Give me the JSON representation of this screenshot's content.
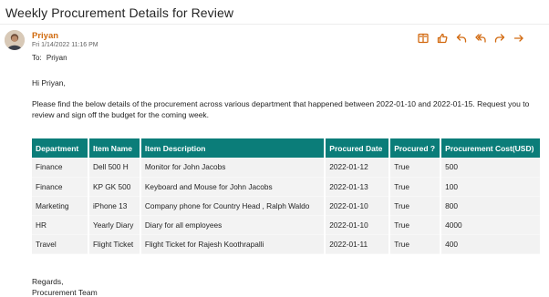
{
  "email": {
    "subject": "Weekly Procurement Details for Review",
    "sender": "Priyan",
    "sent": "Fri 1/14/2022 11:16 PM",
    "to_label": "To:",
    "to": "Priyan",
    "greeting": "Hi Priyan,",
    "intro": "Please find the below details of the procurement across various department that happened between 2022-01-10 and 2022-01-15. Request you to review and sign off the budget for the coming week.",
    "closing": "Regards,",
    "signature": "Procurement Team"
  },
  "actions": [
    {
      "name": "immersive-reader-icon"
    },
    {
      "name": "like-icon"
    },
    {
      "name": "reply-icon"
    },
    {
      "name": "reply-all-icon"
    },
    {
      "name": "forward-icon"
    },
    {
      "name": "more-icon"
    }
  ],
  "table": {
    "headers": [
      "Department",
      "Item Name",
      "Item Description",
      "Procured Date",
      "Procured ?",
      "Procurement Cost(USD)"
    ],
    "rows": [
      [
        "Finance",
        "Dell 500 H",
        "Monitor for John Jacobs",
        "2022-01-12",
        "True",
        "500"
      ],
      [
        "Finance",
        "KP GK 500",
        "Keyboard and Mouse for John Jacobs",
        "2022-01-13",
        "True",
        "100"
      ],
      [
        "Marketing",
        "iPhone 13",
        "Company phone for Country Head , Ralph Waldo",
        "2022-01-10",
        "True",
        "800"
      ],
      [
        "HR",
        "Yearly Diary",
        "Diary for all employees",
        "2022-01-10",
        "True",
        "4000"
      ],
      [
        "Travel",
        "Flight Ticket",
        "Flight Ticket for Rajesh Koothrapalli",
        "2022-01-11",
        "True",
        "400"
      ]
    ]
  },
  "colors": {
    "header_bg": "#0b7d79",
    "sender": "#d06b0f",
    "action_icons": "#d26a10"
  }
}
